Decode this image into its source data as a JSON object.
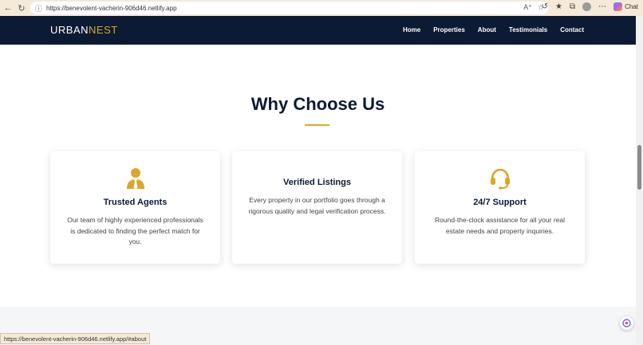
{
  "browser": {
    "url": "https://benevolent-vacherin-906d46.netlify.app",
    "chat_label": "Chat",
    "status_url": "https://benevolent-vacherin-906d46.netlify.app/#about"
  },
  "site": {
    "logo_primary": "URBAN",
    "logo_accent": "NEST",
    "nav": [
      "Home",
      "Properties",
      "About",
      "Testimonials",
      "Contact"
    ]
  },
  "section": {
    "title": "Why Choose Us",
    "cards": [
      {
        "icon": "user-tie-icon",
        "title": "Trusted Agents",
        "text": "Our team of highly experienced professionals is dedicated to finding the perfect match for you."
      },
      {
        "icon": "",
        "title": "Verified Listings",
        "text": "Every property in our portfolio goes through a rigorous quality and legal verification process."
      },
      {
        "icon": "headset-icon",
        "title": "24/7 Support",
        "text": "Round-the-clock assistance for all your real estate needs and property inquiries."
      }
    ]
  },
  "colors": {
    "navy": "#0c1a33",
    "gold": "#d9a82b"
  }
}
